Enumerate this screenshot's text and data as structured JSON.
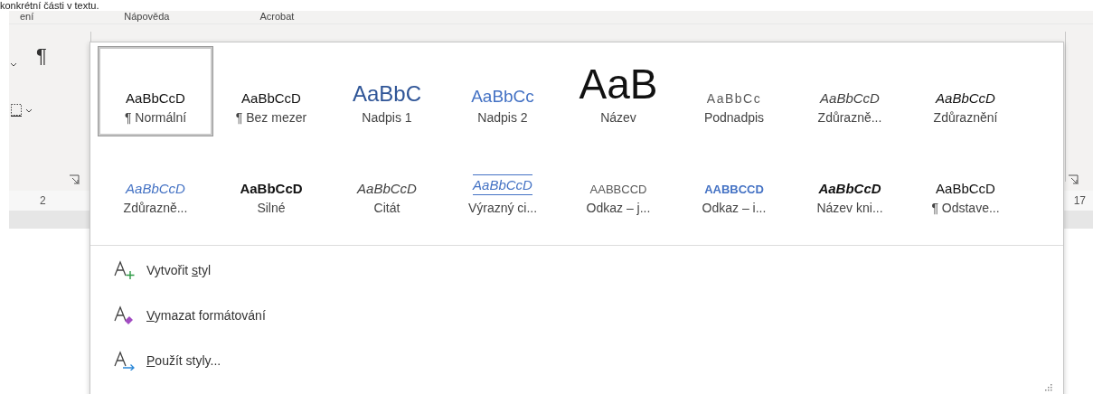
{
  "document_text": "konkrétní části v textu.",
  "ribbon_tabs": [
    {
      "label": "ení"
    },
    {
      "label": "Nápověda"
    },
    {
      "label": "Acrobat"
    }
  ],
  "ruler": {
    "left_mark": "2",
    "right_mark": "17"
  },
  "pilcrow": "¶",
  "styles_gallery": {
    "styles": [
      {
        "preview": "AaBbCcD",
        "label": "¶ Normální",
        "kind": "normal",
        "selected": true
      },
      {
        "preview": "AaBbCcD",
        "label": "¶ Bez mezer",
        "kind": "normal",
        "selected": false
      },
      {
        "preview": "AaBbC",
        "label": "Nadpis 1",
        "kind": "heading1",
        "selected": false
      },
      {
        "preview": "AaBbCc",
        "label": "Nadpis 2",
        "kind": "heading2",
        "selected": false
      },
      {
        "preview": "AaB",
        "label": "Název",
        "kind": "title",
        "selected": false
      },
      {
        "preview": "AaBbCc",
        "label": "Podnadpis",
        "kind": "subtitle",
        "selected": false
      },
      {
        "preview": "AaBbCcD",
        "label": "Zdůrazně...",
        "kind": "subtle-emphasis",
        "selected": false
      },
      {
        "preview": "AaBbCcD",
        "label": "Zdůraznění",
        "kind": "emphasis",
        "selected": false
      },
      {
        "preview": "AaBbCcD",
        "label": "Zdůrazně...",
        "kind": "intense-emphasis",
        "selected": false
      },
      {
        "preview": "AaBbCcD",
        "label": "Silné",
        "kind": "strong",
        "selected": false
      },
      {
        "preview": "AaBbCcD",
        "label": "Citát",
        "kind": "quote",
        "selected": false
      },
      {
        "preview": "AaBbCcD",
        "label": "Výrazný ci...",
        "kind": "intense-quote",
        "selected": false
      },
      {
        "preview": "AABBCCD",
        "label": "Odkaz – j...",
        "kind": "subtle-reference",
        "selected": false
      },
      {
        "preview": "AABBCCD",
        "label": "Odkaz – i...",
        "kind": "intense-reference",
        "selected": false
      },
      {
        "preview": "AaBbCcD",
        "label": "Název kni...",
        "kind": "book-title",
        "selected": false
      },
      {
        "preview": "AaBbCcD",
        "label": "¶ Odstave...",
        "kind": "normal",
        "selected": false
      }
    ]
  },
  "menu": [
    {
      "kind": "create",
      "before": "Vytvořit ",
      "key": "s",
      "after": "tyl"
    },
    {
      "kind": "clear",
      "key": "V",
      "after": "ymazat formátování"
    },
    {
      "kind": "apply",
      "key": "P",
      "after": "oužít styly..."
    }
  ]
}
